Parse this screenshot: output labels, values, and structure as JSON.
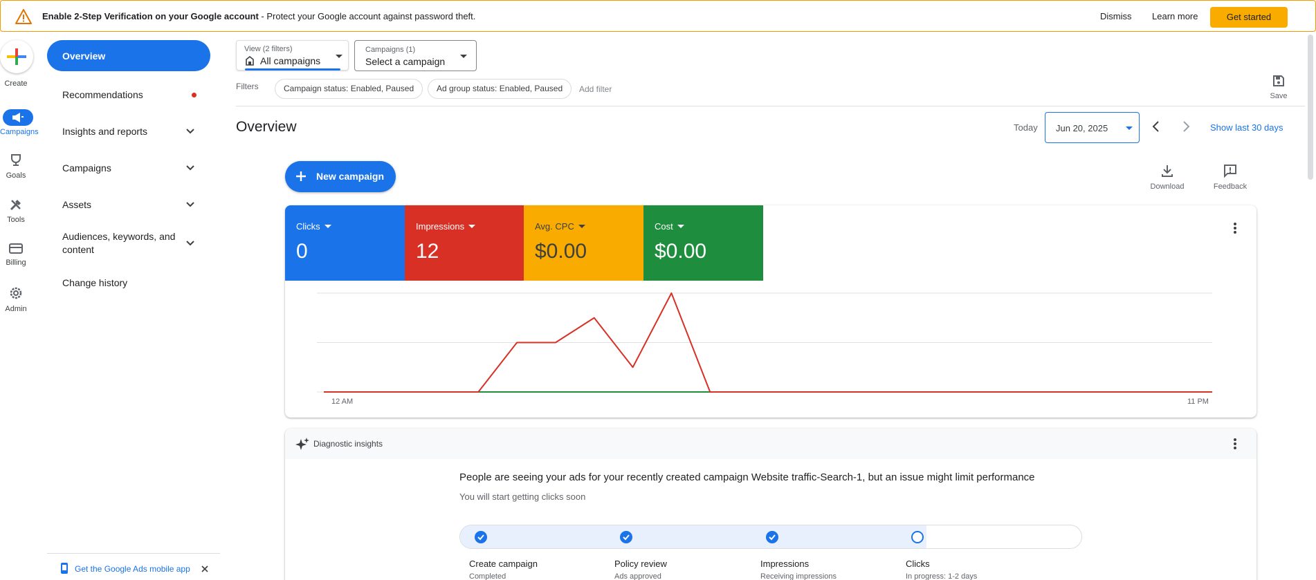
{
  "banner": {
    "title": "Enable 2-Step Verification on your Google account",
    "message": " - Protect your Google account against password theft.",
    "dismiss": "Dismiss",
    "learn_more": "Learn more",
    "get_started": "Get started"
  },
  "rail": {
    "create": "Create",
    "campaigns": "Campaigns",
    "goals": "Goals",
    "tools": "Tools",
    "billing": "Billing",
    "admin": "Admin"
  },
  "nav": {
    "items": [
      {
        "label": "Overview",
        "active": true
      },
      {
        "label": "Recommendations",
        "badge": true
      },
      {
        "label": "Insights and reports",
        "expandable": true
      },
      {
        "label": "Campaigns",
        "expandable": true
      },
      {
        "label": "Assets",
        "expandable": true
      },
      {
        "label": "Audiences, keywords, and content",
        "expandable": true
      },
      {
        "label": "Change history"
      }
    ],
    "mobile_app": "Get the Google Ads mobile app"
  },
  "view_selector": {
    "caption": "View (2 filters)",
    "value": "All campaigns"
  },
  "campaign_selector": {
    "caption": "Campaigns (1)",
    "value": "Select a campaign"
  },
  "filters": {
    "label": "Filters",
    "chips": [
      "Campaign status: Enabled, Paused",
      "Ad group status: Enabled, Paused"
    ],
    "add": "Add filter",
    "save": "Save"
  },
  "overview": {
    "title": "Overview",
    "today": "Today",
    "date": "Jun 20, 2025",
    "last30": "Show last 30 days",
    "new_campaign": "New campaign",
    "download": "Download",
    "feedback": "Feedback"
  },
  "metrics": [
    {
      "name": "Clicks",
      "value": "0",
      "color": "#1a73e8"
    },
    {
      "name": "Impressions",
      "value": "12",
      "color": "#d93025"
    },
    {
      "name": "Avg. CPC",
      "value": "$0.00",
      "color": "#f9ab00"
    },
    {
      "name": "Cost",
      "value": "$0.00",
      "color": "#1e8e3e"
    }
  ],
  "chart_data": {
    "type": "line",
    "x_start_label": "12 AM",
    "x_end_label": "11 PM",
    "x": [
      0,
      1,
      2,
      3,
      4,
      5,
      6,
      7,
      8,
      9,
      10,
      11,
      12,
      13,
      14,
      15,
      16,
      17,
      18,
      19,
      20,
      21,
      22,
      23
    ],
    "ylim": [
      0,
      4
    ],
    "series": [
      {
        "name": "Impressions",
        "color": "#d93025",
        "values": [
          0,
          0,
          0,
          0,
          0,
          2,
          2,
          3,
          1,
          4,
          0,
          0,
          0,
          0,
          0,
          0,
          0,
          0,
          0,
          0,
          0,
          0,
          0,
          0
        ]
      },
      {
        "name": "Clicks",
        "color": "#1a73e8",
        "values": [
          0,
          0,
          0,
          0,
          0,
          0,
          0,
          0,
          0,
          0,
          0,
          0,
          0,
          0,
          0,
          0,
          0,
          0,
          0,
          0,
          0,
          0,
          0,
          0
        ]
      },
      {
        "name": "Cost",
        "color": "#1e8e3e",
        "values": [
          0,
          0,
          0,
          0,
          0,
          0,
          0,
          0,
          0,
          0,
          0,
          0,
          0,
          0,
          0,
          0,
          0,
          0,
          0,
          0,
          0,
          0,
          0,
          0
        ]
      }
    ],
    "grid": true
  },
  "insights": {
    "header": "Diagnostic insights",
    "title": "People are seeing your ads for your recently created campaign Website traffic-Search-1, but an issue might limit performance",
    "subtitle": "You will start getting clicks soon",
    "progress": 0.75,
    "steps": [
      {
        "name": "Create campaign",
        "status": "Completed",
        "done": true
      },
      {
        "name": "Policy review",
        "status": "Ads approved",
        "done": true
      },
      {
        "name": "Impressions",
        "status": "Receiving impressions",
        "done": true
      },
      {
        "name": "Clicks",
        "status": "In progress: 1-2 days",
        "done": false
      }
    ]
  }
}
